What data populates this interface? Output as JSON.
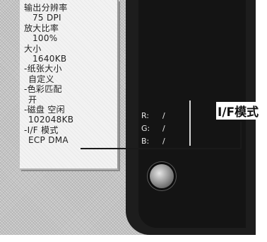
{
  "lcd_menu": {
    "items": [
      {
        "text": "输出分辨率",
        "kind": "label"
      },
      {
        "text": "75 DPI",
        "kind": "value"
      },
      {
        "text": "放大比率",
        "kind": "label"
      },
      {
        "text": "100%",
        "kind": "value"
      },
      {
        "text": "大小",
        "kind": "label"
      },
      {
        "text": "1640KB",
        "kind": "value"
      },
      {
        "text": "-纸张大小",
        "kind": "label"
      },
      {
        "text": "自定义",
        "kind": "value"
      },
      {
        "text": "-色彩匹配",
        "kind": "label"
      },
      {
        "text": "开",
        "kind": "value"
      },
      {
        "text": "-磁盘 空闲",
        "kind": "label"
      },
      {
        "text": "102048KB",
        "kind": "value"
      },
      {
        "text": "-I/F 模式",
        "kind": "label"
      },
      {
        "text": "ECP DMA",
        "kind": "value"
      }
    ]
  },
  "rgb_readout": {
    "rows": [
      {
        "key": "R:",
        "value": "/"
      },
      {
        "key": "G:",
        "value": "/"
      },
      {
        "key": "B:",
        "value": "/"
      }
    ]
  },
  "callout": {
    "label": "I/F模式"
  },
  "colors": {
    "shell": "#cfcfcf",
    "lcd": "#f3f3f3",
    "bezel": "#1d1d1d",
    "text": "#222222"
  },
  "icons": {
    "dial": "dial-knob-icon"
  }
}
